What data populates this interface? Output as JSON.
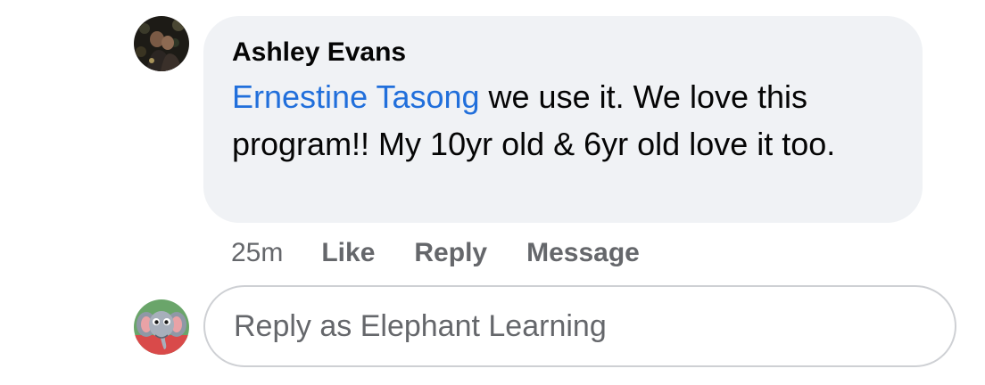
{
  "comment": {
    "author": "Ashley Evans",
    "mention": "Ernestine Tasong",
    "text": " we use it. We love this program!! My 10yr old & 6yr old love it too.",
    "avatar_icon": "user-photo-avatar"
  },
  "actions": {
    "timestamp": "25m",
    "like_label": "Like",
    "reply_label": "Reply",
    "message_label": "Message"
  },
  "reply": {
    "placeholder": "Reply as Elephant Learning",
    "avatar_icon": "elephant-logo-avatar"
  },
  "colors": {
    "mention": "#216fdb",
    "bubble": "#f0f2f5",
    "secondary_text": "#65676b"
  }
}
